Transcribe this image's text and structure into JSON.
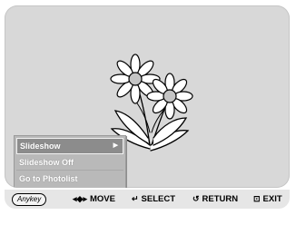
{
  "menu": {
    "items": [
      {
        "label": "Slideshow",
        "selected": true,
        "has_submenu": true
      },
      {
        "label": "Slideshow Off",
        "selected": false,
        "has_submenu": false
      },
      {
        "label": "Go to Photolist",
        "selected": false,
        "has_submenu": false
      }
    ],
    "submenu_arrow": "▶"
  },
  "bottom_bar": {
    "anykey": "Anykey",
    "move": {
      "icon": "move-arrows-icon",
      "glyph": "◂◆▸",
      "label": "MOVE"
    },
    "select": {
      "icon": "enter-icon",
      "glyph": "↵",
      "label": "SELECT"
    },
    "return": {
      "icon": "return-icon",
      "glyph": "↺",
      "label": "RETURN"
    },
    "exit": {
      "icon": "exit-icon",
      "glyph": "⊡",
      "label": "EXIT"
    }
  },
  "photo": {
    "subject": "flower-image"
  }
}
